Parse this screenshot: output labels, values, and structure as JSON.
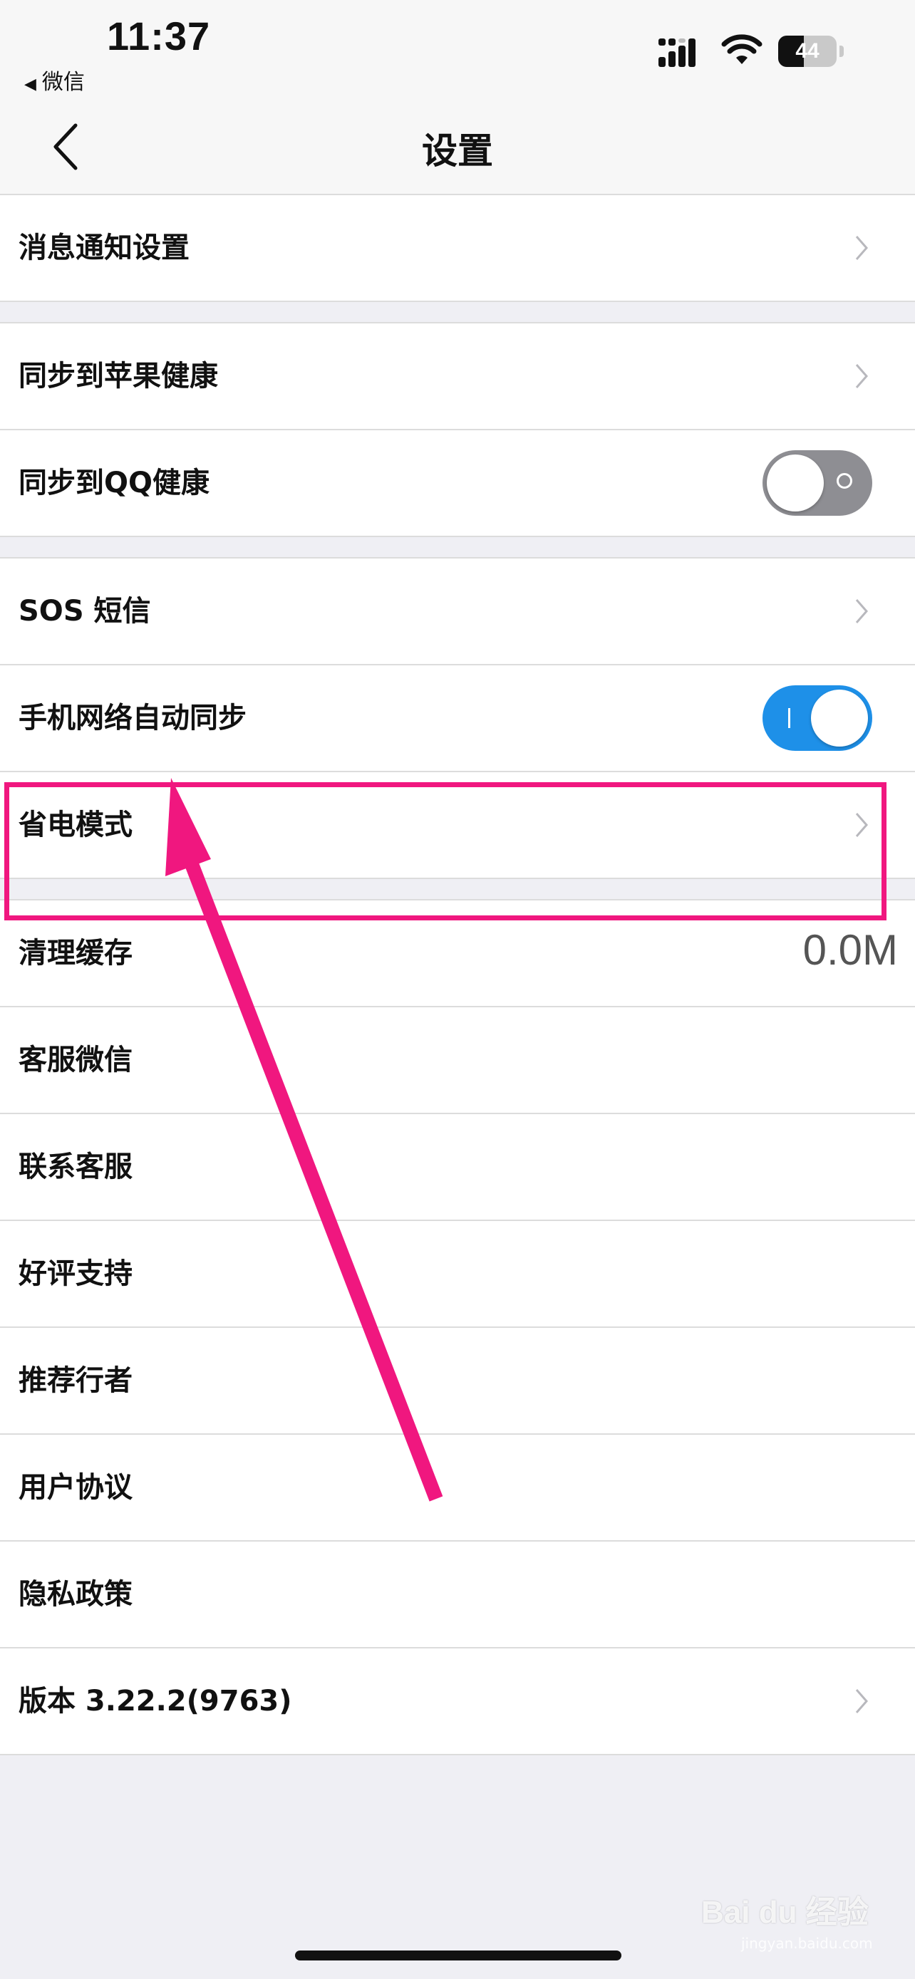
{
  "status_bar": {
    "time": "11:37",
    "back_to_app": "微信",
    "battery": "44",
    "signal_icon": "cellular-signal-icon",
    "wifi_icon": "wifi-icon"
  },
  "nav": {
    "title": "设置"
  },
  "rows": [
    {
      "label": "消息通知设置"
    },
    {
      "label": "同步到苹果健康"
    },
    {
      "label": "同步到QQ健康",
      "toggle": false
    },
    {
      "label": "SOS 短信"
    },
    {
      "label": "手机网络自动同步",
      "toggle": true
    },
    {
      "label": "省电模式"
    },
    {
      "label": "清理缓存",
      "value": "0.0M"
    },
    {
      "label": "客服微信"
    },
    {
      "label": "联系客服"
    },
    {
      "label": "好评支持"
    },
    {
      "label": "推荐行者"
    },
    {
      "label": "用户协议"
    },
    {
      "label": "隐私政策"
    },
    {
      "label": "版本 3.22.2(9763)"
    }
  ],
  "annotation": {
    "color": "#f0177f"
  },
  "watermark": {
    "text": "Bai du 经验",
    "sub": "jingyan.baidu.com"
  }
}
